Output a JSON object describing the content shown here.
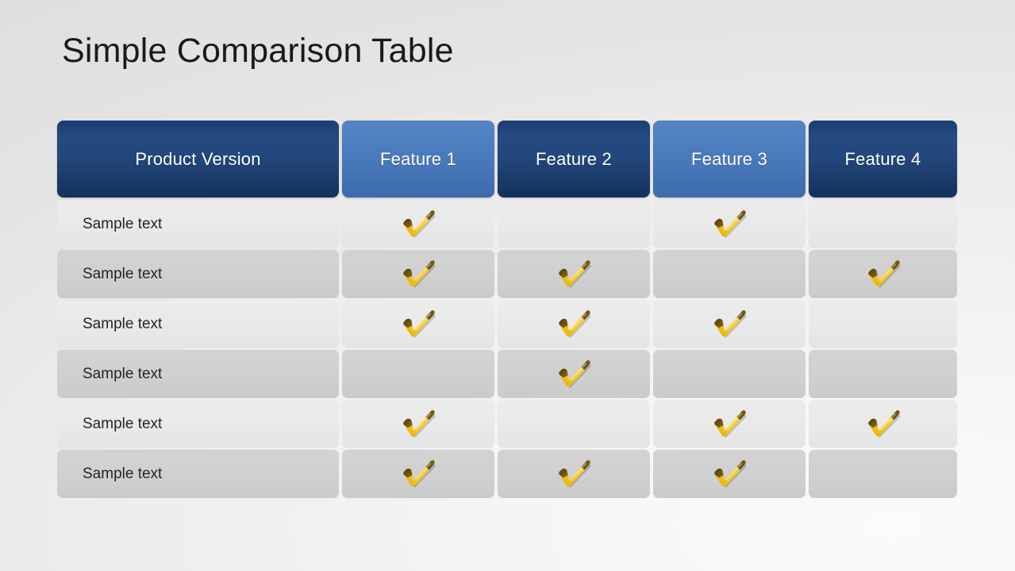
{
  "slide": {
    "title": "Simple Comparison Table",
    "background_color": "#ededed"
  },
  "table": {
    "headers": [
      {
        "label": "Product Version",
        "style": "dark",
        "color": "#1d3f73"
      },
      {
        "label": "Feature 1",
        "style": "light",
        "color": "#4a7fc1"
      },
      {
        "label": "Feature 2",
        "style": "dark",
        "color": "#1d3f73"
      },
      {
        "label": "Feature 3",
        "style": "light",
        "color": "#4a7fc1"
      },
      {
        "label": "Feature 4",
        "style": "dark",
        "color": "#1d3f73"
      }
    ],
    "row_colors": {
      "odd": "#e9e9e9",
      "even": "#d0d0d0"
    },
    "check_icon": {
      "name": "check-mark-icon",
      "color": "#f5c518",
      "accent_color": "#5c4610"
    },
    "rows": [
      {
        "label": "Sample text",
        "shade": "light",
        "checks": [
          true,
          false,
          true,
          false
        ]
      },
      {
        "label": "Sample text",
        "shade": "dark",
        "checks": [
          true,
          true,
          false,
          true
        ]
      },
      {
        "label": "Sample text",
        "shade": "light",
        "checks": [
          true,
          true,
          true,
          false
        ]
      },
      {
        "label": "Sample text",
        "shade": "dark",
        "checks": [
          false,
          true,
          false,
          false
        ]
      },
      {
        "label": "Sample text",
        "shade": "light",
        "checks": [
          true,
          false,
          true,
          true
        ]
      },
      {
        "label": "Sample text",
        "shade": "dark",
        "checks": [
          true,
          true,
          true,
          false
        ]
      }
    ]
  }
}
